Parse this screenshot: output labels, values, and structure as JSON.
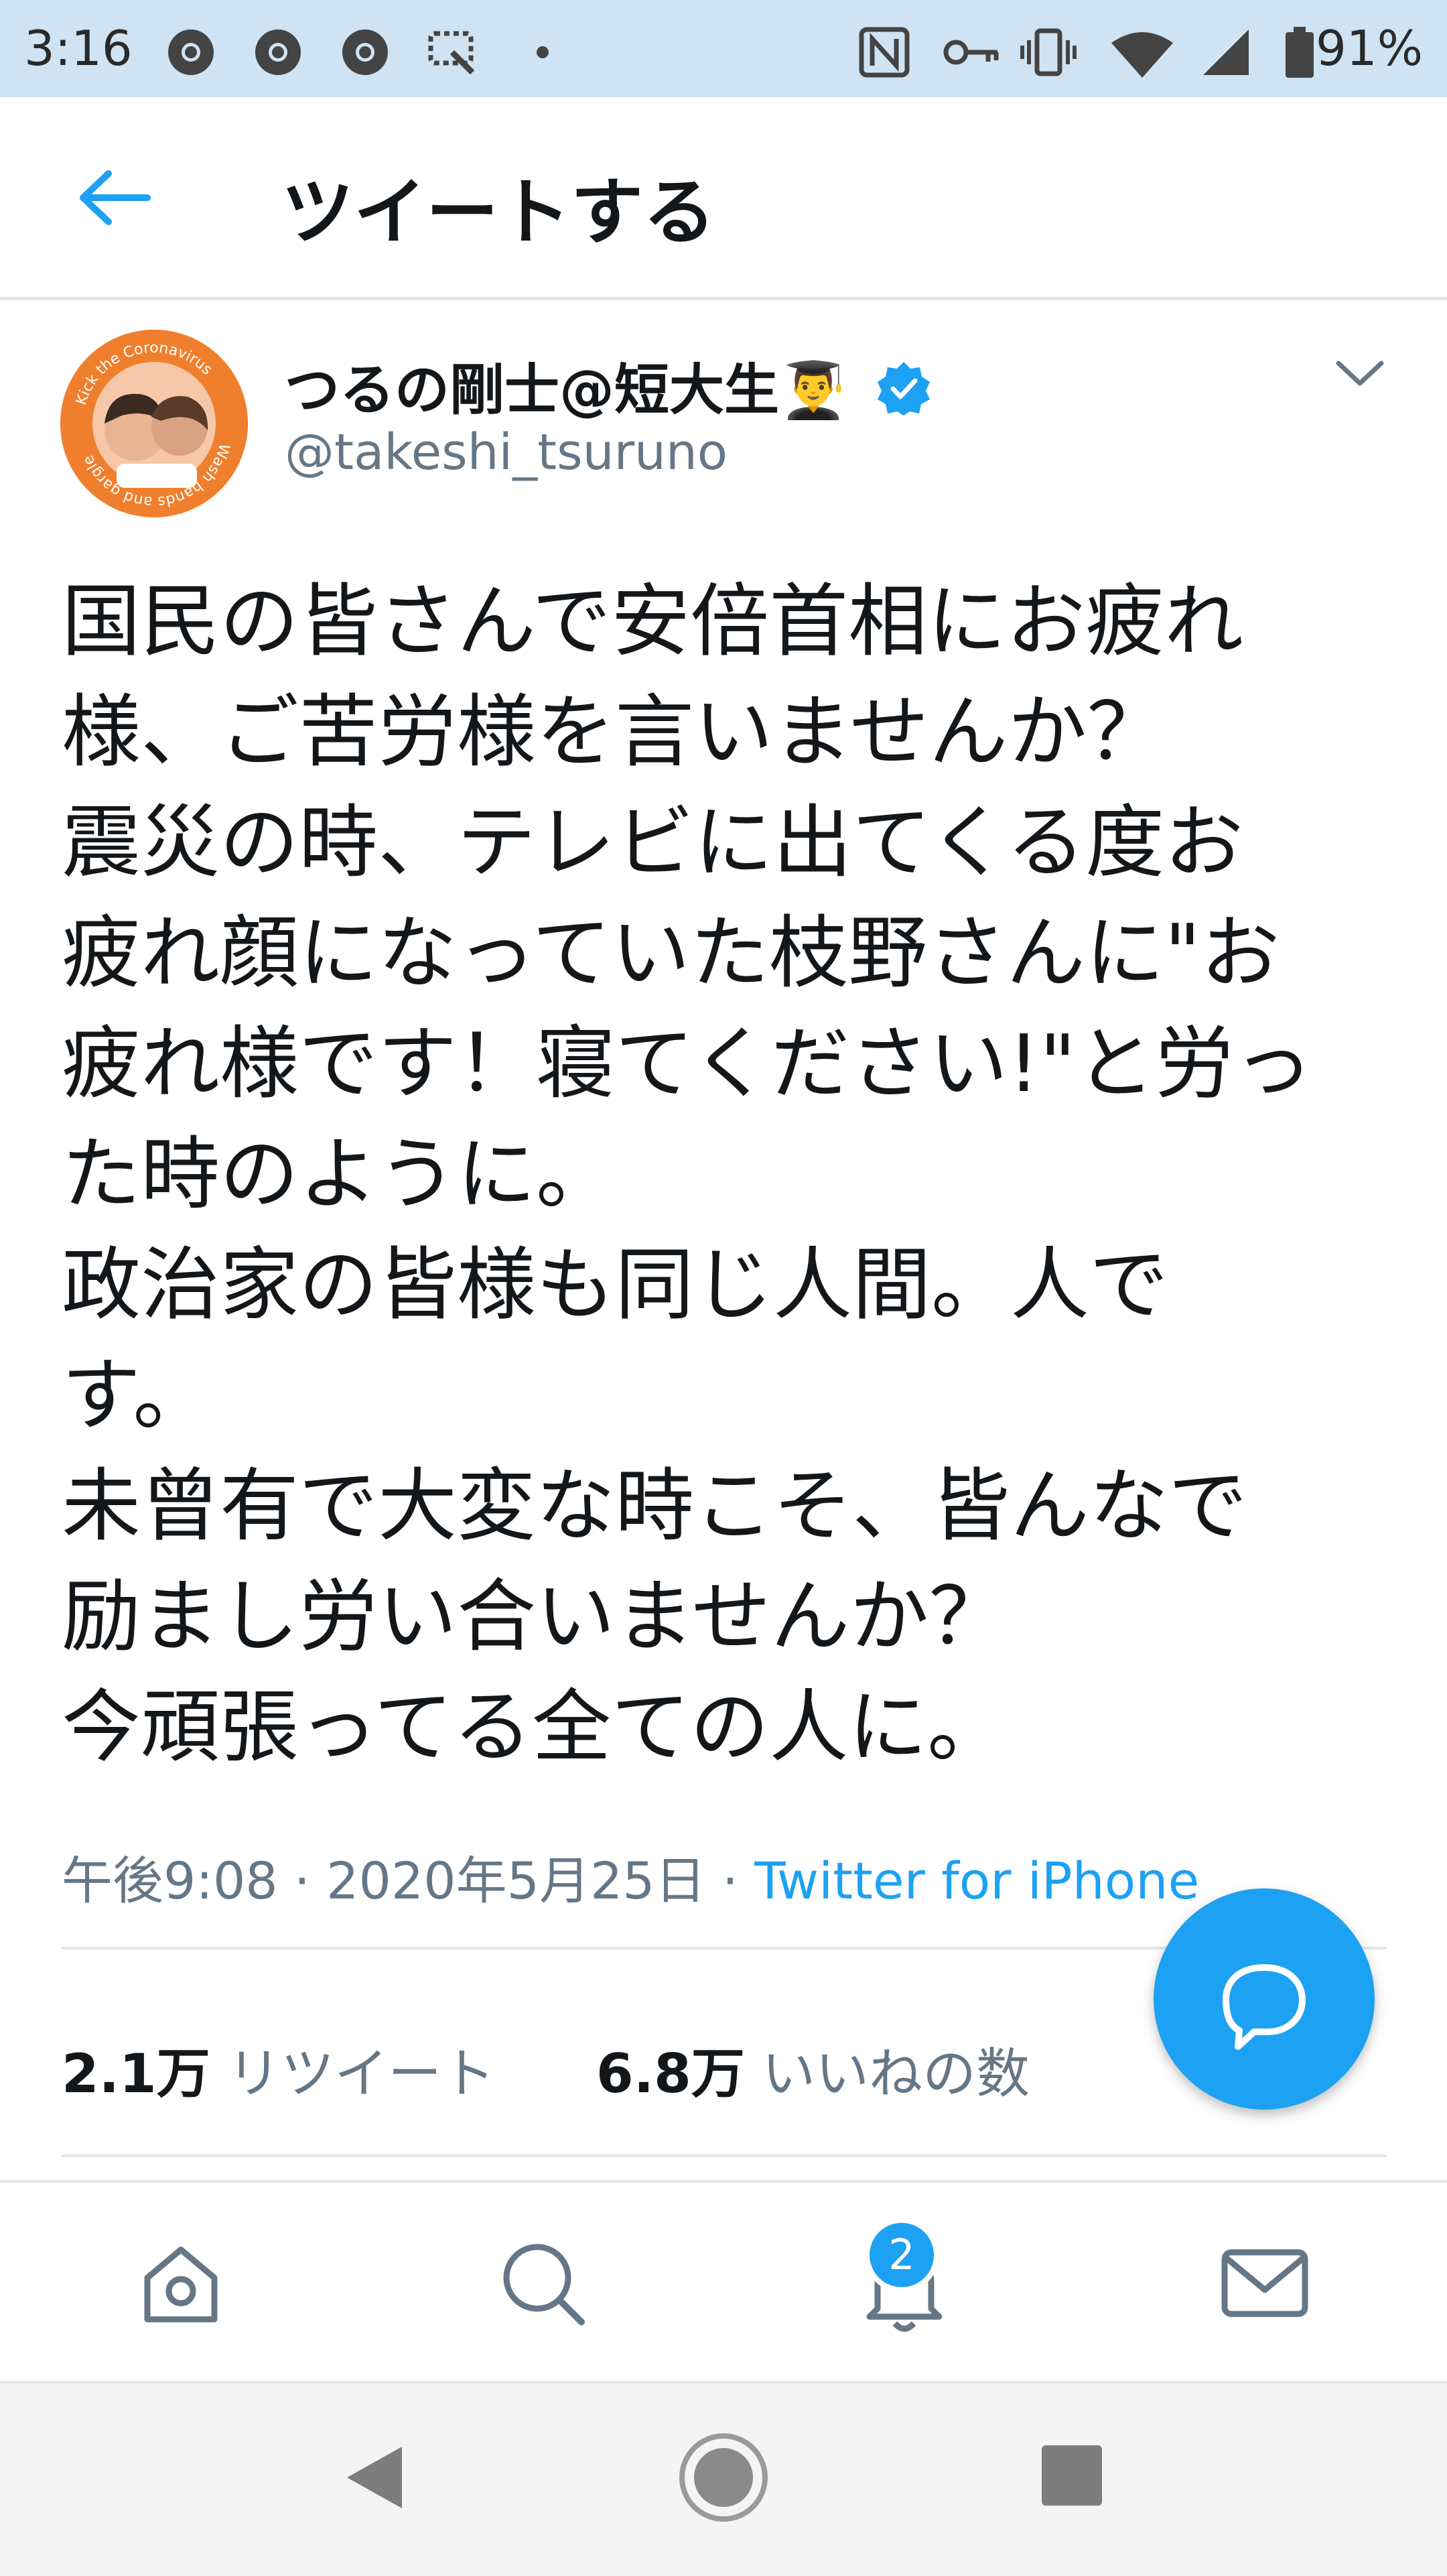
{
  "status_bar": {
    "time": "3:16",
    "battery": "91%"
  },
  "header": {
    "title": "ツイートする"
  },
  "tweet": {
    "display_name": "つるの剛士@短大生👨‍🎓",
    "handle": "@takeshi_tsuruno",
    "avatar_text_top": "Kick the Coronavirus",
    "avatar_text_bottom": "Wash hands and gargle",
    "body_lines": [
      "国民の皆さんで安倍首相にお疲れ",
      "様、ご苦労様を言いませんか？",
      "震災の時、テレビに出てくる度お",
      "疲れ顔になっていた枝野さんに\"お",
      "疲れ様です！寝てください!\"と労っ",
      "た時のように。",
      "政治家の皆様も同じ人間。人で",
      "す。",
      "未曾有で大変な時こそ、皆んなで",
      "励まし労い合いませんか？",
      "今頑張ってる全ての人に。"
    ],
    "time": "午後9:08",
    "date": "2020年5月25日",
    "source": "Twitter for iPhone",
    "retweet_count": "2.1万",
    "retweet_label": "リツイート",
    "like_count": "6.8万",
    "like_label": "いいねの数"
  },
  "tab_bar": {
    "notification_badge": "2"
  },
  "colors": {
    "accent": "#1da1f2",
    "status_bar": "#cfe3f3",
    "avatar": "#f07f2d"
  }
}
